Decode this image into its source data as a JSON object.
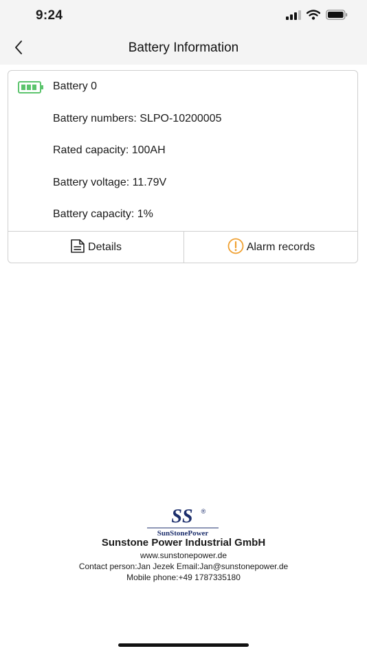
{
  "status_bar": {
    "time": "9:24"
  },
  "nav": {
    "title": "Battery Information"
  },
  "battery_card": {
    "name": "Battery 0",
    "battery_numbers": "Battery numbers: SLPO-10200005",
    "rated_capacity": "Rated capacity: 100AH",
    "battery_voltage": "Battery voltage: 11.79V",
    "battery_capacity": "Battery capacity: 1%",
    "details_label": "Details",
    "alarm_label": "Alarm records"
  },
  "footer": {
    "logo_text": "SunStonePower",
    "company": "Sunstone Power Industrial GmbH",
    "website": "www.sunstonepower.de",
    "contact": "Contact person:Jan Jezek Email:Jan@sunstonepower.de",
    "mobile": "Mobile phone:+49 1787335180"
  },
  "colors": {
    "battery_icon": "#5cc46d",
    "alarm_icon": "#f0a030",
    "logo_navy": "#1c2e6c"
  },
  "icons": {
    "back": "chevron-left-icon",
    "battery": "battery-icon",
    "details": "document-icon",
    "alarm": "warning-circle-icon"
  }
}
